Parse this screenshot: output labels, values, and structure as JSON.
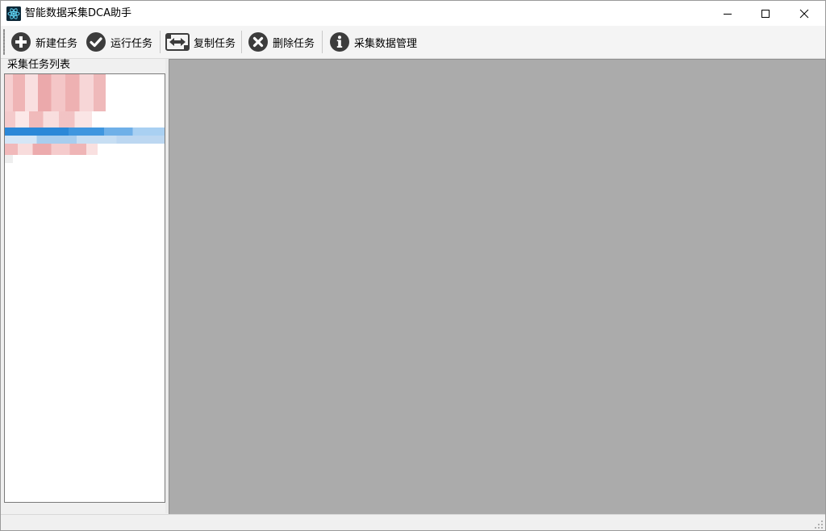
{
  "window": {
    "title": "智能数据采集DCA助手",
    "app_icon": "atom-icon",
    "controls": {
      "minimize_icon": "minimize-icon",
      "maximize_icon": "maximize-icon",
      "close_icon": "close-icon"
    }
  },
  "toolbar": {
    "buttons": [
      {
        "label": "新建任务",
        "icon": "plus-circle-icon"
      },
      {
        "label": "运行任务",
        "icon": "check-circle-icon"
      },
      {
        "label": "复制任务",
        "icon": "copy-arrows-icon"
      },
      {
        "label": "删除任务",
        "icon": "x-circle-icon"
      },
      {
        "label": "采集数据管理",
        "icon": "info-circle-icon"
      }
    ]
  },
  "task_panel": {
    "label": "采集任务列表"
  },
  "colors": {
    "selection": "#2b88d8",
    "main_pane": "#ababab",
    "blur_pink": "#f0b8b8",
    "icon_dark": "#3c3c3c"
  }
}
